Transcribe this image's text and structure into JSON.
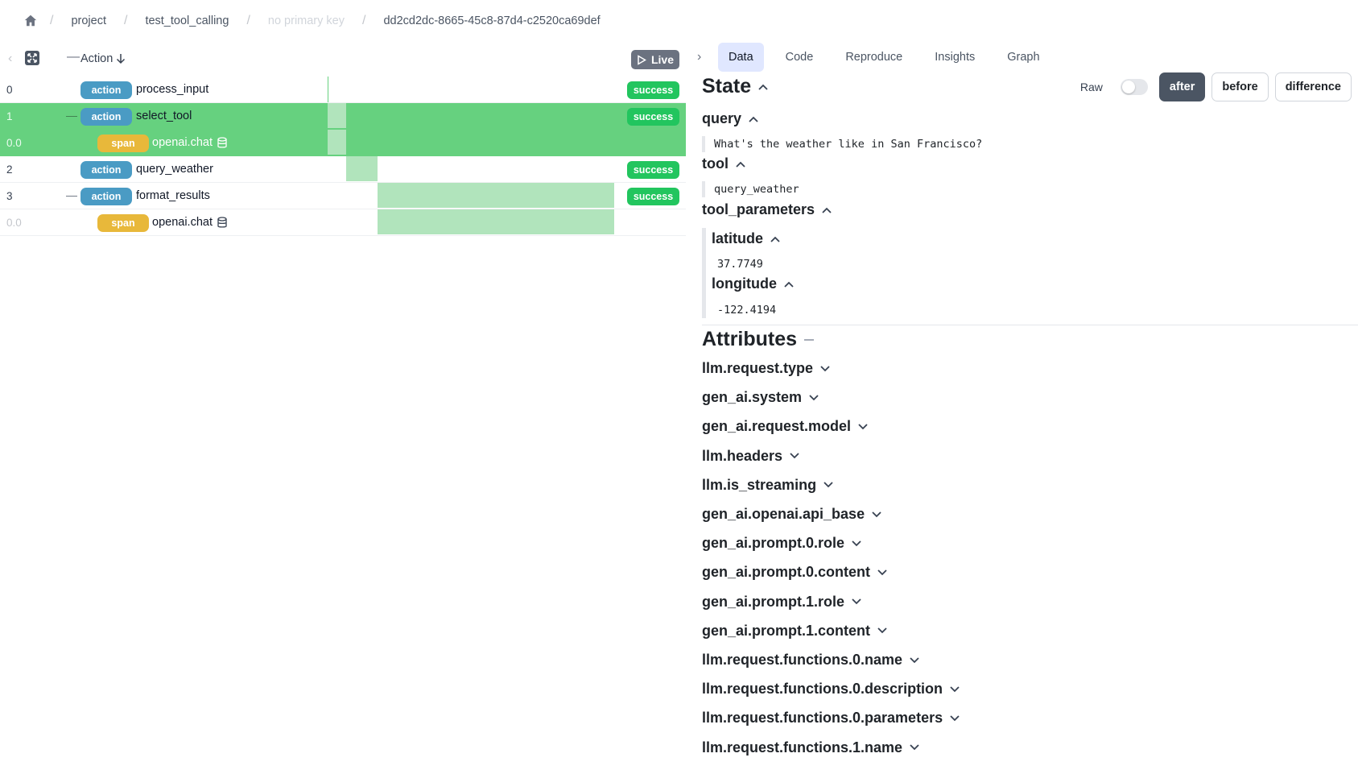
{
  "breadcrumb": {
    "items": [
      "project",
      "test_tool_calling",
      "no primary key",
      "dd2cd2dc-8665-45c8-87d4-c2520ca69def"
    ]
  },
  "left_header": {
    "column_label": "Action",
    "live_label": "Live"
  },
  "rows": [
    {
      "index": "0",
      "kind": "action",
      "name": "process_input",
      "status": "success"
    },
    {
      "index": "1",
      "kind": "action",
      "name": "select_tool",
      "status": "success"
    },
    {
      "index": "0.0",
      "kind": "span",
      "name": "openai.chat",
      "status": ""
    },
    {
      "index": "2",
      "kind": "action",
      "name": "query_weather",
      "status": "success"
    },
    {
      "index": "3",
      "kind": "action",
      "name": "format_results",
      "status": "success"
    },
    {
      "index": "0.0",
      "kind": "span",
      "name": "openai.chat",
      "status": ""
    }
  ],
  "tabs": [
    "Data",
    "Code",
    "Reproduce",
    "Insights",
    "Graph"
  ],
  "state": {
    "title": "State",
    "raw_label": "Raw",
    "buttons": [
      "after",
      "before",
      "difference"
    ],
    "query_label": "query",
    "query_value": "What's the weather like in San Francisco?",
    "tool_label": "tool",
    "tool_value": "query_weather",
    "tool_parameters_label": "tool_parameters",
    "latitude_label": "latitude",
    "latitude_value": "37.7749",
    "longitude_label": "longitude",
    "longitude_value": "-122.4194"
  },
  "attributes": {
    "title": "Attributes",
    "items": [
      "llm.request.type",
      "gen_ai.system",
      "gen_ai.request.model",
      "llm.headers",
      "llm.is_streaming",
      "gen_ai.openai.api_base",
      "gen_ai.prompt.0.role",
      "gen_ai.prompt.0.content",
      "gen_ai.prompt.1.role",
      "gen_ai.prompt.1.content",
      "llm.request.functions.0.name",
      "llm.request.functions.0.description",
      "llm.request.functions.0.parameters",
      "llm.request.functions.1.name"
    ]
  },
  "colors": {
    "action_badge": "#4a9bc4",
    "span_badge": "#e8b83a",
    "success": "#22c55e",
    "selected_row": "#66d17f",
    "timeline_bar": "#b1e4bc",
    "active_tab": "#e0e7ff"
  }
}
